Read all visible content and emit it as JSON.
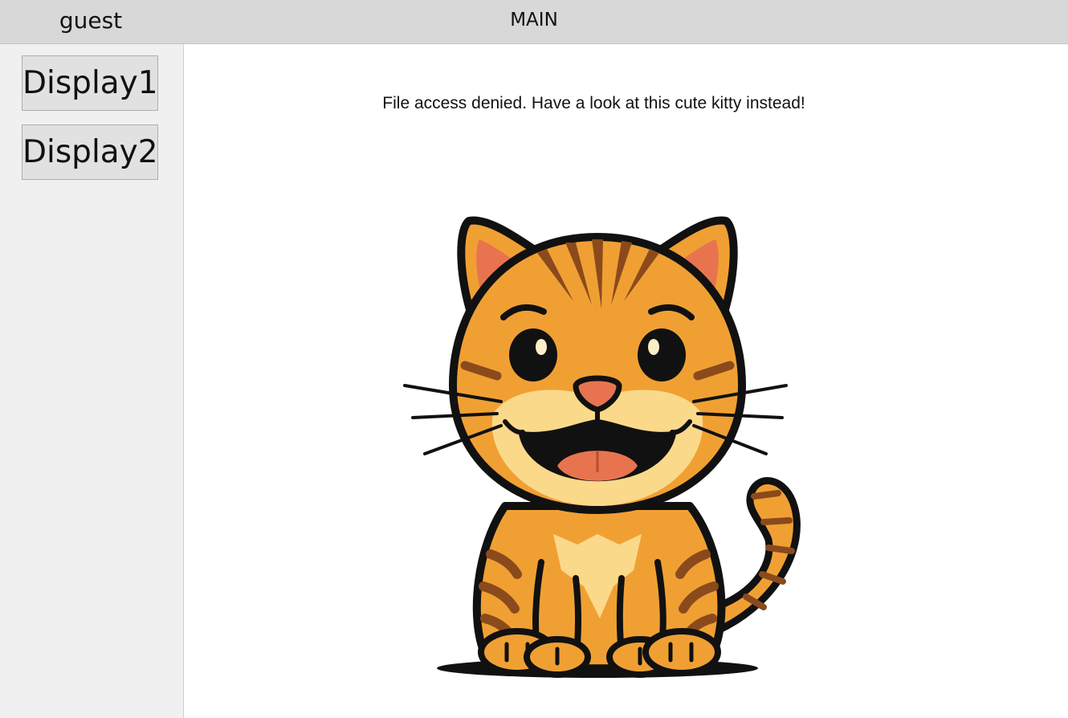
{
  "header": {
    "user": "guest",
    "title": "MAIN"
  },
  "sidebar": {
    "buttons": [
      {
        "label": "Display1"
      },
      {
        "label": "Display2"
      }
    ]
  },
  "main": {
    "message": "File access denied. Have a look at this cute kitty instead!",
    "image": {
      "icon": "cartoon-kitten",
      "colors": {
        "fur": "#f0a033",
        "stripe": "#8b4a1c",
        "cream": "#fbd98a",
        "pink": "#e8744f",
        "outline": "#111111"
      }
    }
  }
}
